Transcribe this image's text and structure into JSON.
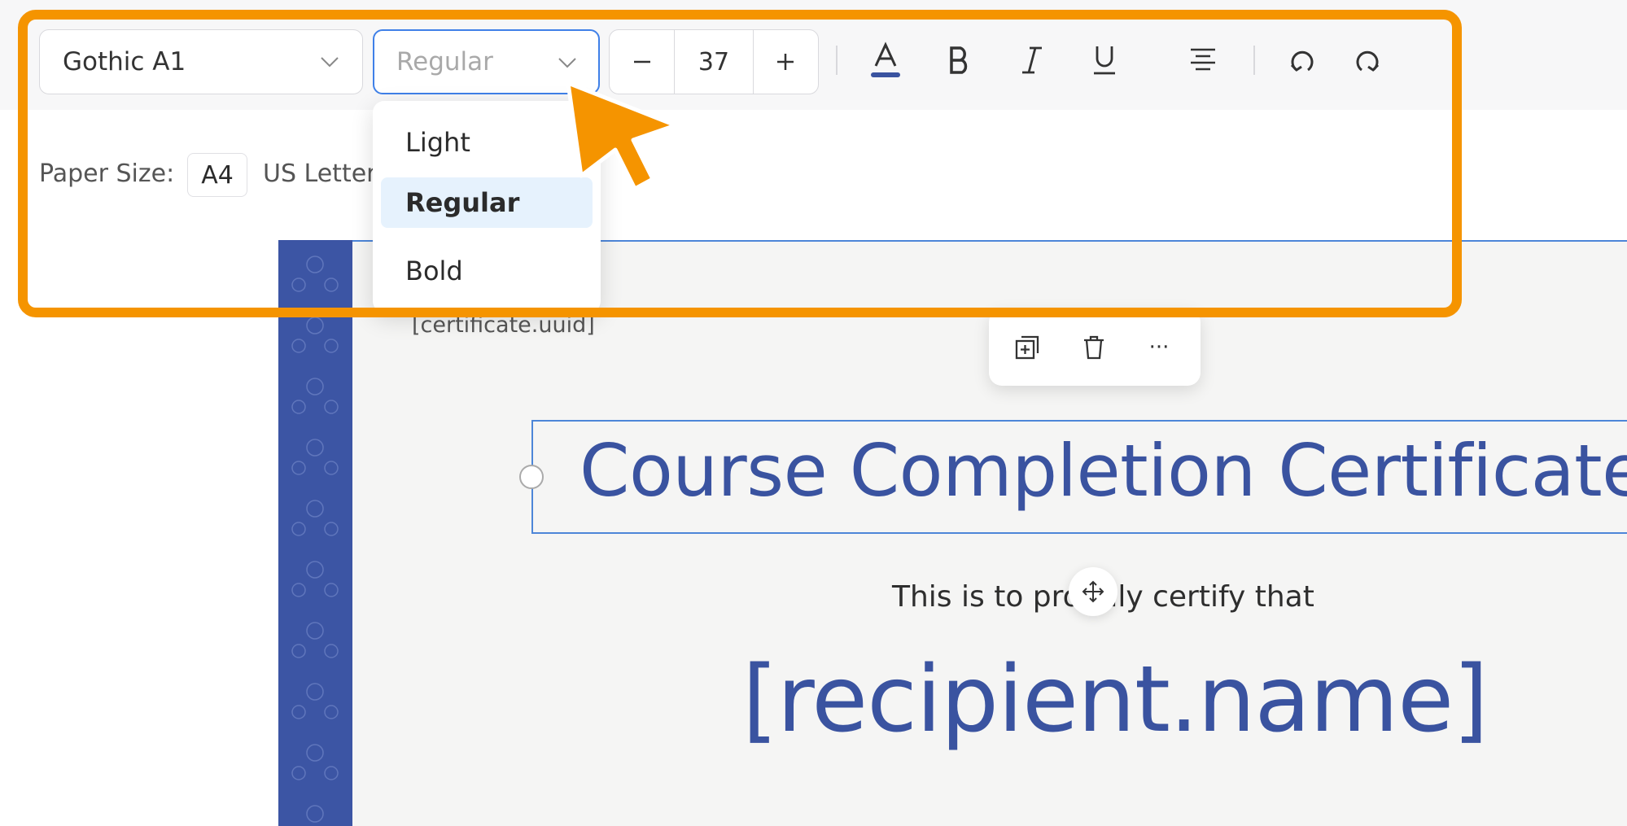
{
  "toolbar": {
    "font_family": "Gothic A1",
    "font_weight": {
      "value": "Regular",
      "options": [
        "Light",
        "Regular",
        "Bold"
      ],
      "selected": "Regular"
    },
    "font_size": "37",
    "decrement_label": "−",
    "increment_label": "+",
    "text_color": "#3a53a0",
    "icons": [
      "text-color-icon",
      "bold-icon",
      "italic-icon",
      "underline-icon",
      "align-center-icon",
      "undo-icon",
      "redo-icon"
    ]
  },
  "paper_size": {
    "label": "Paper Size:",
    "options": [
      "A4",
      "US Letter"
    ],
    "selected": "A4"
  },
  "certificate": {
    "uuid": "[certificate.uuid]",
    "title": "Course Completion Certificate",
    "certify_line": "This is to proudly certify that",
    "recipient": "[recipient.name]"
  },
  "element_toolbar": {
    "icons": [
      "duplicate-icon",
      "delete-icon",
      "more-icon"
    ],
    "more_label": "···"
  },
  "colors": {
    "accent": "#3f80e8",
    "certificate_blue": "#3a53a0",
    "highlight": "#f59400",
    "selected_item_bg": "#e6f2fd"
  }
}
